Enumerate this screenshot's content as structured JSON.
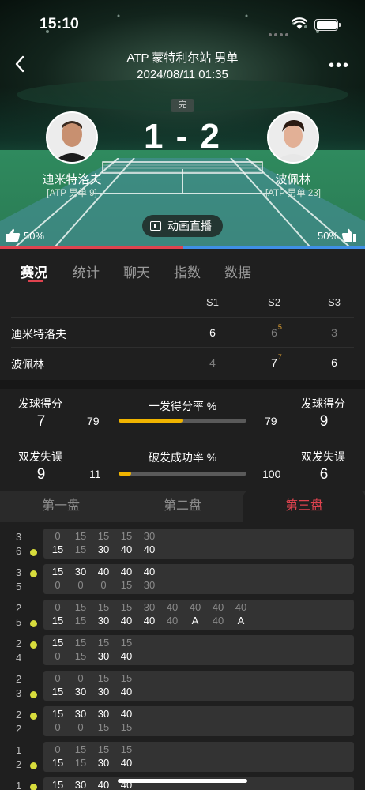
{
  "status_bar": {
    "time": "15:10"
  },
  "header": {
    "title": "ATP 蒙特利尔站 男单",
    "datetime": "2024/08/11 01:35",
    "status": "完",
    "score": "1 - 2"
  },
  "players": {
    "left": {
      "name": "迪米特洛夫",
      "rank": "[ATP 男单 9]",
      "likes": "50%"
    },
    "right": {
      "name": "波佩林",
      "rank": "[ATP 男单 23]",
      "likes": "50%"
    }
  },
  "vote": {
    "left_fraction": 0.5
  },
  "animation_button": "动画直播",
  "tabs": [
    "赛况",
    "统计",
    "聊天",
    "指数",
    "数据"
  ],
  "set_table": {
    "headers": [
      "S1",
      "S2",
      "S3"
    ],
    "rows": [
      {
        "name": "迪米特洛夫",
        "sets": [
          "6",
          "6",
          "3"
        ],
        "tiebreak": [
          "",
          "5",
          ""
        ],
        "win": [
          true,
          false,
          false
        ]
      },
      {
        "name": "波佩林",
        "sets": [
          "4",
          "7",
          "6"
        ],
        "tiebreak": [
          "",
          "7",
          ""
        ],
        "win": [
          false,
          true,
          true
        ]
      }
    ]
  },
  "stats": {
    "serve_points_label": "发球得分",
    "serve_points_left": "7",
    "serve_points_right": "9",
    "first_serve_title": "一发得分率 %",
    "first_serve_left": "79",
    "first_serve_right": "79",
    "first_serve_fraction": 0.5,
    "double_faults_label": "双发失误",
    "double_faults_left": "9",
    "double_faults_right": "6",
    "break_title": "破发成功率 %",
    "break_left": "11",
    "break_right": "100",
    "break_fraction": 0.1
  },
  "set_tabs": [
    "第一盘",
    "第二盘",
    "第三盘"
  ],
  "games": [
    {
      "top_score": "3",
      "bot_score": "6",
      "server": "bottom",
      "top": [
        "0",
        "15",
        "15",
        "15",
        "30"
      ],
      "bot": [
        "15",
        "15",
        "30",
        "40",
        "40"
      ],
      "top_hi": [
        false,
        false,
        false,
        false,
        false
      ],
      "bot_hi": [
        true,
        false,
        true,
        true,
        true
      ]
    },
    {
      "top_score": "3",
      "bot_score": "5",
      "server": "top",
      "top": [
        "15",
        "30",
        "40",
        "40",
        "40"
      ],
      "bot": [
        "0",
        "0",
        "0",
        "15",
        "30"
      ],
      "top_hi": [
        true,
        true,
        true,
        true,
        true
      ],
      "bot_hi": [
        false,
        false,
        false,
        false,
        false
      ]
    },
    {
      "top_score": "2",
      "bot_score": "5",
      "server": "bottom",
      "top": [
        "0",
        "15",
        "15",
        "15",
        "30",
        "40",
        "40",
        "40",
        "40"
      ],
      "bot": [
        "15",
        "15",
        "30",
        "40",
        "40",
        "40",
        "A",
        "40",
        "A"
      ],
      "top_hi": [
        false,
        false,
        false,
        false,
        false,
        false,
        false,
        false,
        false
      ],
      "bot_hi": [
        true,
        false,
        true,
        true,
        true,
        false,
        true,
        false,
        true
      ]
    },
    {
      "top_score": "2",
      "bot_score": "4",
      "server": "top",
      "top": [
        "15",
        "15",
        "15",
        "15"
      ],
      "bot": [
        "0",
        "15",
        "30",
        "40"
      ],
      "top_hi": [
        true,
        false,
        false,
        false
      ],
      "bot_hi": [
        false,
        false,
        true,
        true
      ]
    },
    {
      "top_score": "2",
      "bot_score": "3",
      "server": "bottom",
      "top": [
        "0",
        "0",
        "15",
        "15"
      ],
      "bot": [
        "15",
        "30",
        "30",
        "40"
      ],
      "top_hi": [
        false,
        false,
        false,
        false
      ],
      "bot_hi": [
        true,
        true,
        true,
        true
      ]
    },
    {
      "top_score": "2",
      "bot_score": "2",
      "server": "top",
      "top": [
        "15",
        "30",
        "30",
        "40"
      ],
      "bot": [
        "0",
        "0",
        "15",
        "15"
      ],
      "top_hi": [
        true,
        true,
        true,
        true
      ],
      "bot_hi": [
        false,
        false,
        false,
        false
      ]
    },
    {
      "top_score": "1",
      "bot_score": "2",
      "server": "bottom",
      "top": [
        "0",
        "15",
        "15",
        "15"
      ],
      "bot": [
        "15",
        "15",
        "30",
        "40"
      ],
      "top_hi": [
        false,
        false,
        false,
        false
      ],
      "bot_hi": [
        true,
        false,
        true,
        true
      ]
    },
    {
      "top_score": "1",
      "bot_score": "",
      "server": "top",
      "top": [
        "15",
        "30",
        "40",
        "40"
      ],
      "bot": [],
      "top_hi": [
        true,
        true,
        true,
        true
      ],
      "bot_hi": []
    }
  ]
}
